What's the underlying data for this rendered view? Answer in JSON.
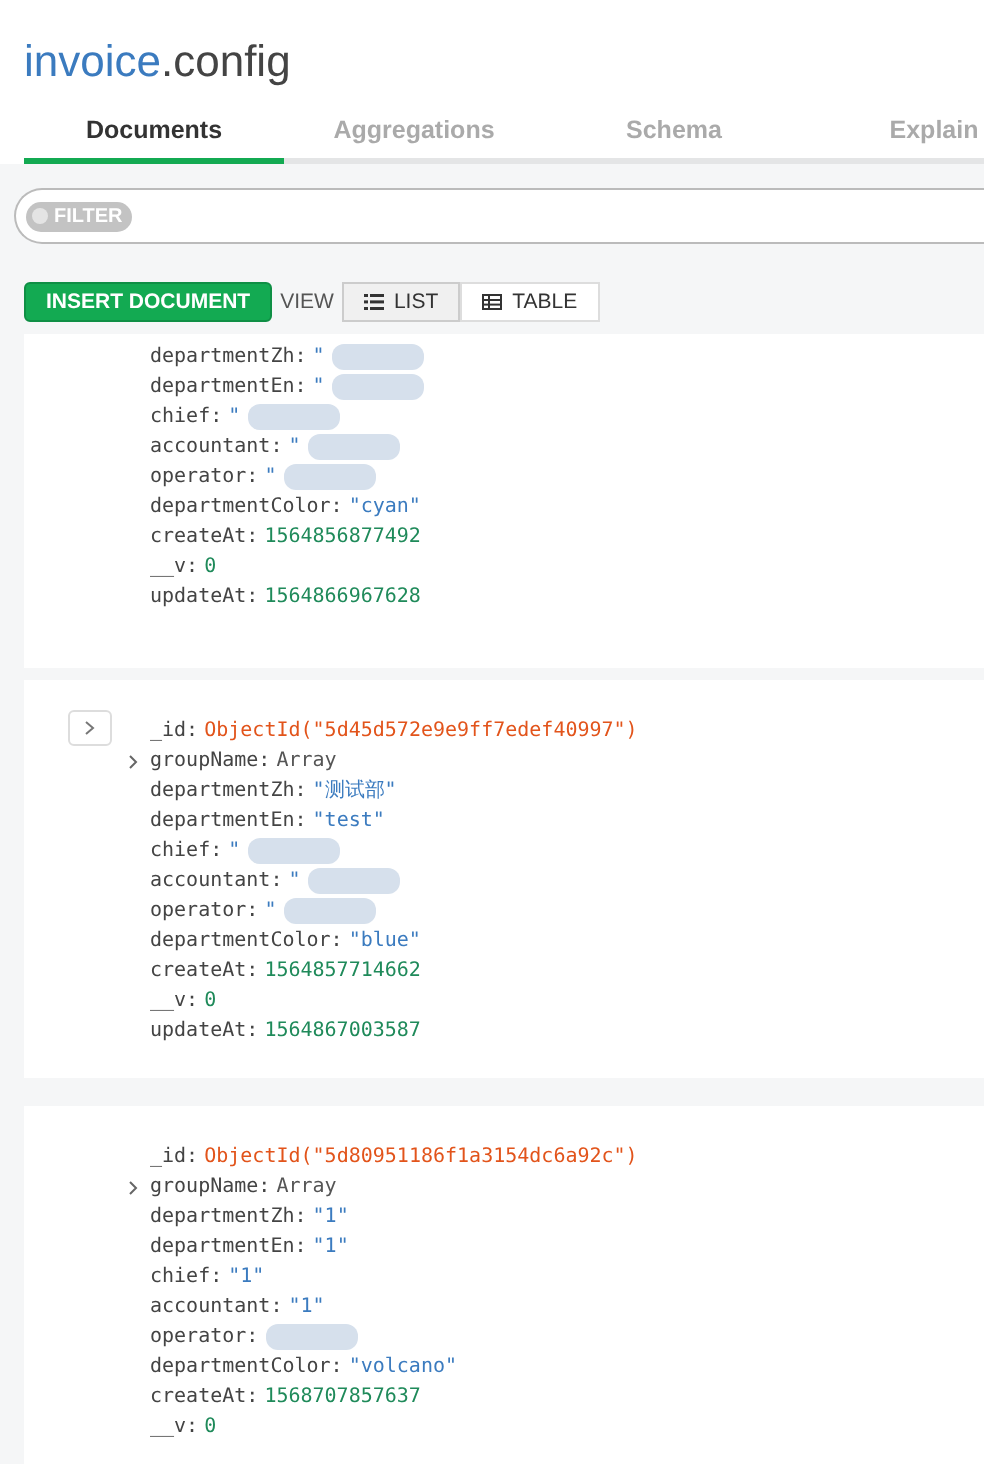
{
  "title": {
    "db": "invoice",
    "collection": ".config"
  },
  "tabs": [
    {
      "label": "Documents",
      "selected": true
    },
    {
      "label": "Aggregations",
      "selected": false
    },
    {
      "label": "Schema",
      "selected": false
    },
    {
      "label": "Explain",
      "selected": false
    }
  ],
  "filter": {
    "label": "FILTER"
  },
  "toolbar": {
    "insert": "INSERT DOCUMENT",
    "view_label": "VIEW",
    "views": [
      {
        "label": "LIST",
        "selected": true
      },
      {
        "label": "TABLE",
        "selected": false
      }
    ]
  },
  "documents": [
    {
      "expand_button": false,
      "fields": [
        {
          "key": "departmentZh:",
          "value": "\"",
          "kind": "string",
          "redacted": true
        },
        {
          "key": "departmentEn:",
          "value": "\"",
          "kind": "string",
          "redacted": true
        },
        {
          "key": "chief:",
          "value": "\"",
          "kind": "string",
          "redacted": true
        },
        {
          "key": "accountant:",
          "value": "\"",
          "kind": "string",
          "redacted": true
        },
        {
          "key": "operator:",
          "value": "\"",
          "kind": "string",
          "redacted": true
        },
        {
          "key": "departmentColor:",
          "value": "\"cyan\"",
          "kind": "string",
          "redacted": false
        },
        {
          "key": "createAt:",
          "value": "1564856877492",
          "kind": "number",
          "redacted": false
        },
        {
          "key": "__v:",
          "value": "0",
          "kind": "number",
          "redacted": false
        },
        {
          "key": "updateAt:",
          "value": "1564866967628",
          "kind": "number",
          "redacted": false
        }
      ]
    },
    {
      "expand_button": true,
      "fields": [
        {
          "key": "_id:",
          "value": "ObjectId(\"5d45d572e9e9ff7edef40997\")",
          "kind": "objectid",
          "redacted": false
        },
        {
          "key": "groupName:",
          "value": "Array",
          "kind": "array",
          "redacted": false
        },
        {
          "key": "departmentZh:",
          "value": "\"测试部\"",
          "kind": "string",
          "redacted": false
        },
        {
          "key": "departmentEn:",
          "value": "\"test\"",
          "kind": "string",
          "redacted": false
        },
        {
          "key": "chief:",
          "value": "\"",
          "kind": "string",
          "redacted": true
        },
        {
          "key": "accountant:",
          "value": "\"",
          "kind": "string",
          "redacted": true
        },
        {
          "key": "operator:",
          "value": "\"",
          "kind": "string",
          "redacted": true
        },
        {
          "key": "departmentColor:",
          "value": "\"blue\"",
          "kind": "string",
          "redacted": false
        },
        {
          "key": "createAt:",
          "value": "1564857714662",
          "kind": "number",
          "redacted": false
        },
        {
          "key": "__v:",
          "value": "0",
          "kind": "number",
          "redacted": false
        },
        {
          "key": "updateAt:",
          "value": "1564867003587",
          "kind": "number",
          "redacted": false
        }
      ]
    },
    {
      "expand_button": false,
      "fields": [
        {
          "key": "_id:",
          "value": "ObjectId(\"5d80951186f1a3154dc6a92c\")",
          "kind": "objectid",
          "redacted": false
        },
        {
          "key": "groupName:",
          "value": "Array",
          "kind": "array",
          "redacted": false
        },
        {
          "key": "departmentZh:",
          "value": "\"1\"",
          "kind": "string",
          "redacted": false
        },
        {
          "key": "departmentEn:",
          "value": "\"1\"",
          "kind": "string",
          "redacted": false
        },
        {
          "key": "chief:",
          "value": "\"1\"",
          "kind": "string",
          "redacted": false
        },
        {
          "key": "accountant:",
          "value": "\"1\"",
          "kind": "string",
          "redacted": false
        },
        {
          "key": "operator:",
          "kind": "string",
          "redacted": true
        },
        {
          "key": "departmentColor:",
          "value": "\"volcano\"",
          "kind": "string",
          "redacted": false
        },
        {
          "key": "createAt:",
          "value": "1568707857637",
          "kind": "number",
          "redacted": false
        },
        {
          "key": "__v:",
          "value": "0",
          "kind": "number",
          "redacted": false
        }
      ]
    }
  ]
}
